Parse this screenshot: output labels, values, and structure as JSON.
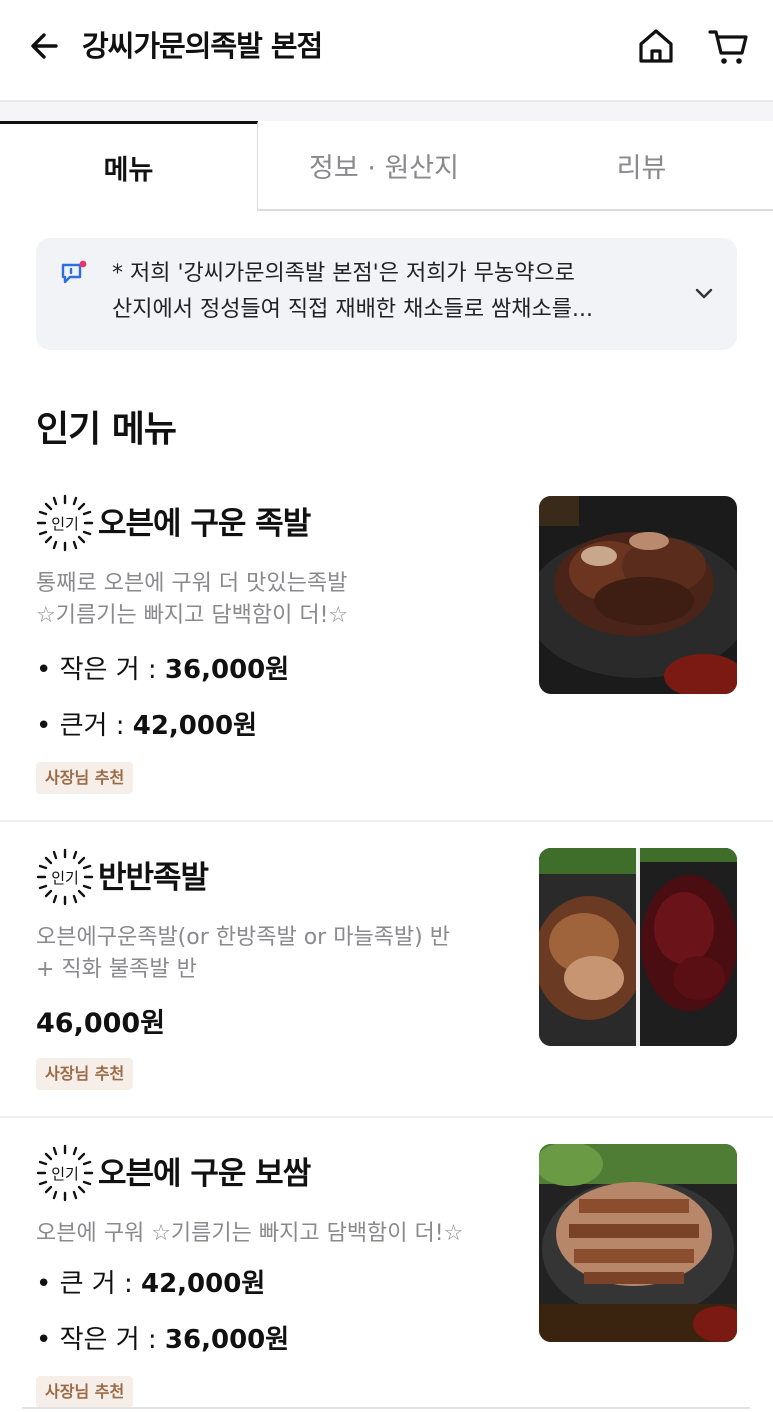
{
  "header": {
    "title": "강씨가문의족발 본점",
    "icons": {
      "back": "arrow-left-icon",
      "home": "home-icon",
      "cart": "cart-icon"
    }
  },
  "tabs": [
    {
      "label": "메뉴",
      "active": true
    },
    {
      "label": "정보 · 원산지",
      "active": false
    },
    {
      "label": "리뷰",
      "active": false
    }
  ],
  "notice": {
    "line1": "* 저희 '강씨가문의족발 본점'은 저희가 무농약으로",
    "line2": "산지에서 정성들여 직접 재배한 채소들로 쌈채소를..."
  },
  "section": {
    "title": "인기 메뉴"
  },
  "badge_label": "인기",
  "items": [
    {
      "name": "오븐에 구운 족발",
      "desc_line1": "통째로 오븐에 구워 더 맛있는족발",
      "desc_line2": "☆기름기는 빠지고 담백함이 더!☆",
      "price1_label": "• 작은 거 : ",
      "price1_value": "36,000원",
      "price2_label": "• 큰거 : ",
      "price2_value": "42,000원",
      "tag": "사장님 추천"
    },
    {
      "name": "반반족발",
      "desc_line1": "오븐에구운족발(or 한방족발 or 마늘족발) 반",
      "desc_line2": "+ 직화 불족발 반",
      "price": "46,000원",
      "tag": "사장님 추천"
    },
    {
      "name": "오븐에 구운 보쌈",
      "desc_line1": "오븐에 구워 ☆기름기는 빠지고 담백함이 더!☆",
      "price1_label": "• 큰 거 : ",
      "price1_value": "42,000원",
      "price2_label": "• 작은 거 : ",
      "price2_value": "36,000원",
      "tag": "사장님 추천"
    }
  ],
  "colors": {
    "accent_tag_bg": "#f6efe9",
    "accent_tag_text": "#9a6b45",
    "notice_bg": "#f1f3f6",
    "badge_dot": "#e8336b"
  }
}
